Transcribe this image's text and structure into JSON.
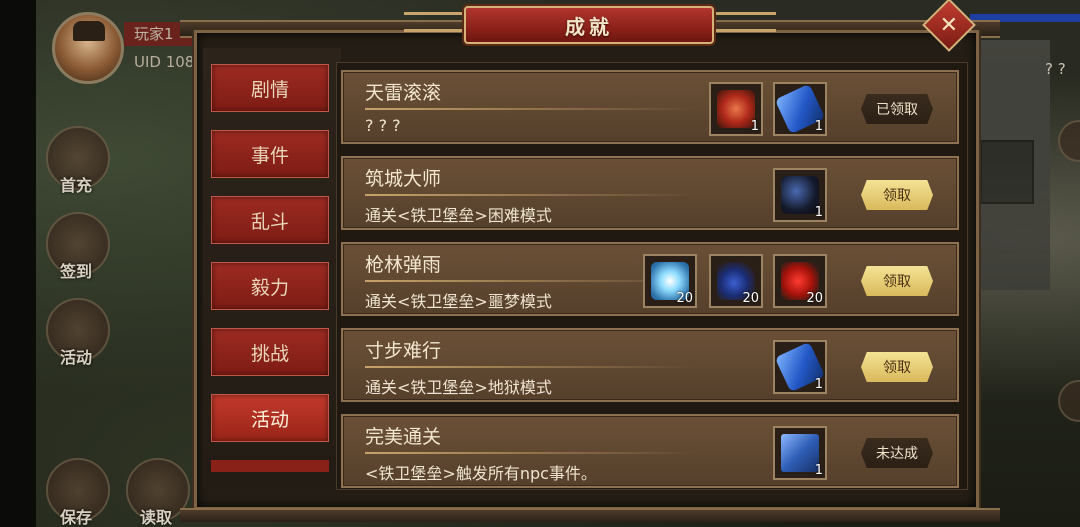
{
  "player": {
    "name": "玩家1",
    "uid": "UID  108"
  },
  "left_menu": [
    {
      "label": "首充",
      "icon": "gift-icon"
    },
    {
      "label": "签到",
      "icon": "checkin-icon"
    },
    {
      "label": "活动",
      "icon": "event-icon"
    },
    {
      "label": "保存",
      "icon": "save-icon"
    },
    {
      "label": "读取",
      "icon": "load-icon"
    }
  ],
  "right_hint": "? ?",
  "dialog": {
    "title": "成就",
    "close_icon": "close-icon",
    "tabs": [
      "剧情",
      "事件",
      "乱斗",
      "毅力",
      "挑战",
      "活动"
    ],
    "active_tab": "活动",
    "achievements": [
      {
        "title": "天雷滚滚",
        "desc": "? ? ?",
        "rewards": [
          {
            "icon": "red-dragon-token-icon",
            "qty": "1"
          },
          {
            "icon": "blue-scroll-icon",
            "qty": "1"
          }
        ],
        "button": "已领取",
        "state": "done"
      },
      {
        "title": "筑城大师",
        "desc": "通关<铁卫堡垒>困难模式",
        "rewards": [
          {
            "icon": "warhorse-icon",
            "qty": "1"
          }
        ],
        "button": "领取",
        "state": "claim"
      },
      {
        "title": "枪林弹雨",
        "desc": "通关<铁卫堡垒>噩梦模式",
        "rewards": [
          {
            "icon": "ice-crystal-icon",
            "qty": "20"
          },
          {
            "icon": "blue-berry-icon",
            "qty": "20"
          },
          {
            "icon": "red-fruit-icon",
            "qty": "20"
          }
        ],
        "button": "领取",
        "state": "claim"
      },
      {
        "title": "寸步难行",
        "desc": "通关<铁卫堡垒>地狱模式",
        "rewards": [
          {
            "icon": "blue-scroll-icon",
            "qty": "1"
          }
        ],
        "button": "领取",
        "state": "claim"
      },
      {
        "title": "完美通关",
        "desc": "<铁卫堡垒>触发所有npc事件。",
        "rewards": [
          {
            "icon": "blue-book-icon",
            "qty": "1"
          }
        ],
        "button": "未达成",
        "state": "done"
      }
    ]
  },
  "colors": {
    "tab_red": "#9d2b22",
    "row_brown": "#6b5036",
    "claim_gold": "#e8cf78",
    "title_red": "#b1352e"
  }
}
